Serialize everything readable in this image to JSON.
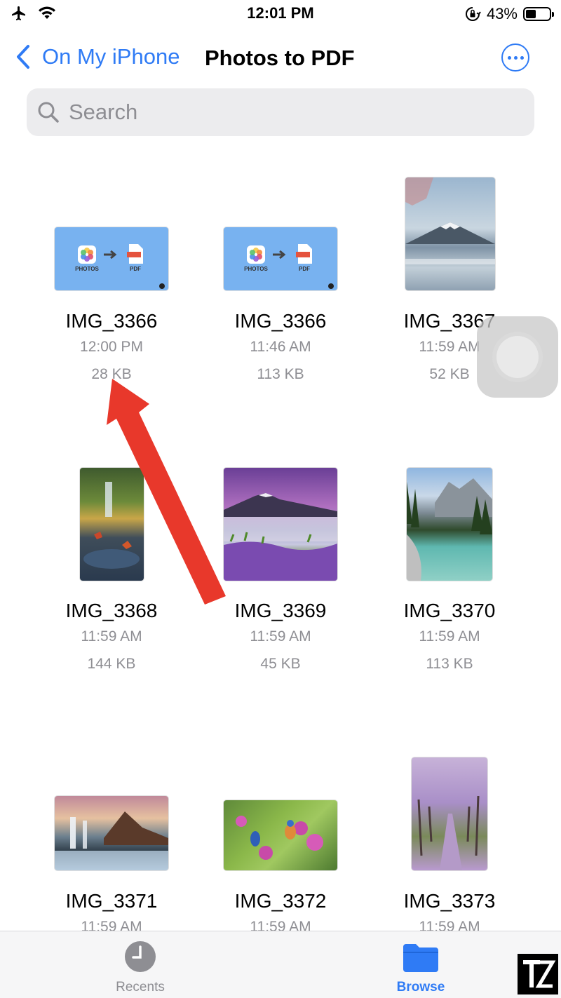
{
  "status_bar": {
    "time": "12:01 PM",
    "battery_percent": "43%",
    "battery_level": 0.43
  },
  "nav": {
    "back_label": "On My iPhone",
    "title": "Photos to PDF"
  },
  "search": {
    "placeholder": "Search"
  },
  "files": [
    {
      "name": "IMG_3366",
      "time": "12:00 PM",
      "size": "28 KB",
      "thumb": "photos-to-pdf-thumbnail",
      "thumb_text": {
        "left": "PHOTOS",
        "right": "PDF"
      }
    },
    {
      "name": "IMG_3366",
      "time": "11:46 AM",
      "size": "113 KB",
      "thumb": "photos-to-pdf-thumbnail",
      "thumb_text": {
        "left": "PHOTOS",
        "right": "PDF"
      }
    },
    {
      "name": "IMG_3367",
      "time": "11:59 AM",
      "size": "52 KB",
      "thumb": "mount-fuji-lake"
    },
    {
      "name": "IMG_3368",
      "time": "11:59 AM",
      "size": "144 KB",
      "thumb": "waterfall-autumn-leaves"
    },
    {
      "name": "IMG_3369",
      "time": "11:59 AM",
      "size": "45 KB",
      "thumb": "mountain-lake-flowers"
    },
    {
      "name": "IMG_3370",
      "time": "11:59 AM",
      "size": "113 KB",
      "thumb": "turquoise-lake-forest"
    },
    {
      "name": "IMG_3371",
      "time": "11:59 AM",
      "size": "",
      "thumb": "waterfall-mountain"
    },
    {
      "name": "IMG_3372",
      "time": "11:59 AM",
      "size": "",
      "thumb": "birds-on-blossoms"
    },
    {
      "name": "IMG_3373",
      "time": "11:59 AM",
      "size": "",
      "thumb": "cherry-blossom-path"
    }
  ],
  "tabbar": {
    "recents_label": "Recents",
    "browse_label": "Browse",
    "active": "Browse"
  },
  "colors": {
    "accent": "#2f7bf5",
    "arrow": "#e8382b",
    "thumb_blue": "#78b2f0"
  }
}
